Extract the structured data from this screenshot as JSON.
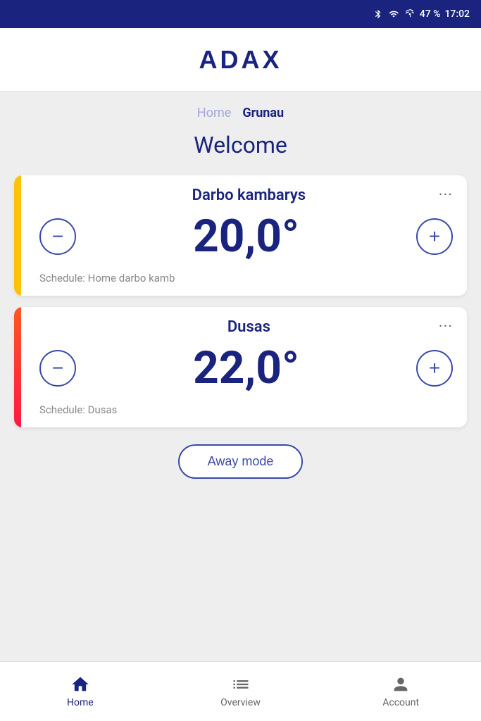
{
  "statusBar": {
    "battery": "47 %",
    "time": "17:02"
  },
  "header": {
    "logo": "ADAX"
  },
  "breadcrumb": {
    "items": [
      {
        "label": "Home",
        "active": false
      },
      {
        "label": "Grunau",
        "active": true
      }
    ]
  },
  "main": {
    "welcomeText": "Welcome",
    "devices": [
      {
        "name": "Darbo kambarys",
        "temperature": "20,0°",
        "schedule": "Schedule: Home darbo kamb",
        "accentColor": "yellow"
      },
      {
        "name": "Dusas",
        "temperature": "22,0°",
        "schedule": "Schedule: Dusas",
        "accentColor": "orange-red"
      }
    ],
    "awayModeLabel": "Away mode"
  },
  "bottomNav": {
    "items": [
      {
        "id": "home",
        "label": "Home",
        "active": true
      },
      {
        "id": "overview",
        "label": "Overview",
        "active": false
      },
      {
        "id": "account",
        "label": "Account",
        "active": false
      }
    ]
  },
  "controls": {
    "decreaseLabel": "−",
    "increaseLabel": "+"
  }
}
